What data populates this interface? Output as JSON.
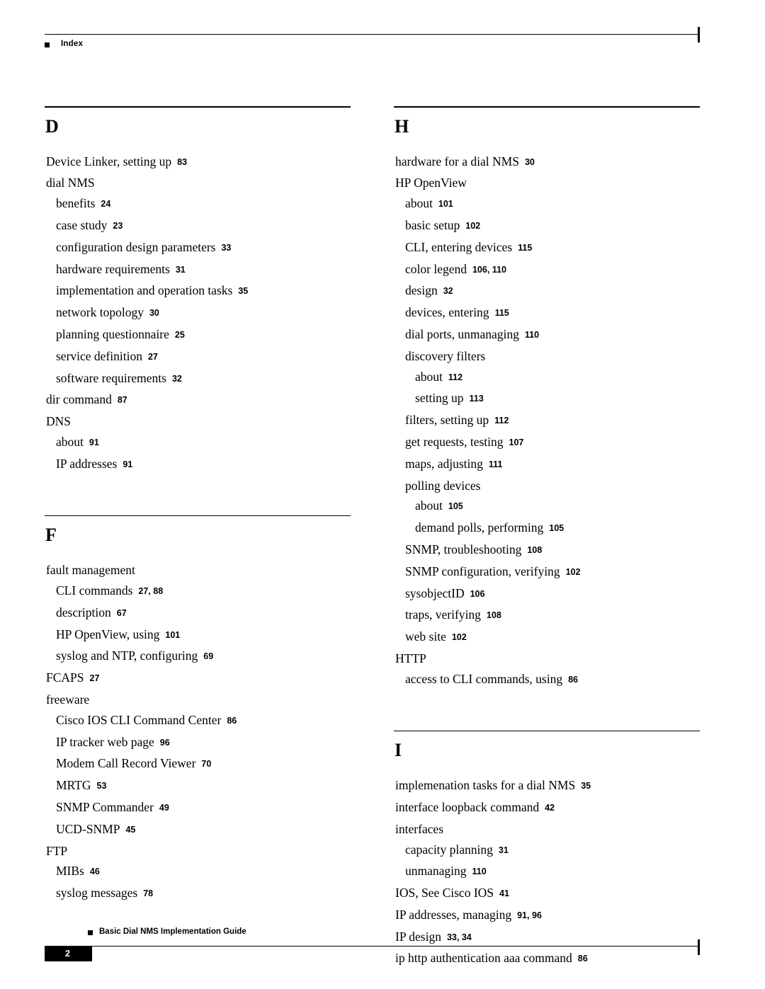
{
  "header": {
    "label": "Index"
  },
  "footer": {
    "guide_title": "Basic Dial NMS Implementation Guide",
    "page_number": "2"
  },
  "columns": [
    {
      "name": "left",
      "blocks": [
        {
          "letter": "D",
          "entries": [
            {
              "level": 1,
              "text": "Device Linker, setting up",
              "pages": "83"
            },
            {
              "level": 1,
              "text": "dial NMS",
              "pages": ""
            },
            {
              "level": 2,
              "text": "benefits",
              "pages": "24"
            },
            {
              "level": 2,
              "text": "case study",
              "pages": "23"
            },
            {
              "level": 2,
              "text": "configuration design parameters",
              "pages": "33"
            },
            {
              "level": 2,
              "text": "hardware requirements",
              "pages": "31"
            },
            {
              "level": 2,
              "text": "implementation and operation tasks",
              "pages": "35"
            },
            {
              "level": 2,
              "text": "network topology",
              "pages": "30"
            },
            {
              "level": 2,
              "text": "planning questionnaire",
              "pages": "25"
            },
            {
              "level": 2,
              "text": "service definition",
              "pages": "27"
            },
            {
              "level": 2,
              "text": "software requirements",
              "pages": "32"
            },
            {
              "level": 1,
              "text": "dir command",
              "pages": "87"
            },
            {
              "level": 1,
              "text": "DNS",
              "pages": ""
            },
            {
              "level": 2,
              "text": "about",
              "pages": "91"
            },
            {
              "level": 2,
              "text": "IP addresses",
              "pages": "91"
            }
          ]
        },
        {
          "letter": "F",
          "entries": [
            {
              "level": 1,
              "text": "fault management",
              "pages": ""
            },
            {
              "level": 2,
              "text": "CLI commands",
              "pages": "27, 88"
            },
            {
              "level": 2,
              "text": "description",
              "pages": "67"
            },
            {
              "level": 2,
              "text": "HP OpenView, using",
              "pages": "101"
            },
            {
              "level": 2,
              "text": "syslog and NTP, configuring",
              "pages": "69"
            },
            {
              "level": 1,
              "text": "FCAPS",
              "pages": "27"
            },
            {
              "level": 1,
              "text": "freeware",
              "pages": ""
            },
            {
              "level": 2,
              "text": "Cisco IOS CLI Command Center",
              "pages": "86"
            },
            {
              "level": 2,
              "text": "IP tracker web page",
              "pages": "96"
            },
            {
              "level": 2,
              "text": "Modem Call Record Viewer",
              "pages": "70"
            },
            {
              "level": 2,
              "text": "MRTG",
              "pages": "53"
            },
            {
              "level": 2,
              "text": "SNMP Commander",
              "pages": "49"
            },
            {
              "level": 2,
              "text": "UCD-SNMP",
              "pages": "45"
            },
            {
              "level": 1,
              "text": "FTP",
              "pages": ""
            },
            {
              "level": 2,
              "text": "MIBs",
              "pages": "46"
            },
            {
              "level": 2,
              "text": "syslog messages",
              "pages": "78"
            }
          ]
        }
      ]
    },
    {
      "name": "right",
      "blocks": [
        {
          "letter": "H",
          "entries": [
            {
              "level": 1,
              "text": "hardware for a dial NMS",
              "pages": "30"
            },
            {
              "level": 1,
              "text": "HP OpenView",
              "pages": ""
            },
            {
              "level": 2,
              "text": "about",
              "pages": "101"
            },
            {
              "level": 2,
              "text": "basic setup",
              "pages": "102"
            },
            {
              "level": 2,
              "text": "CLI, entering devices",
              "pages": "115"
            },
            {
              "level": 2,
              "text": "color legend",
              "pages": "106, 110"
            },
            {
              "level": 2,
              "text": "design",
              "pages": "32"
            },
            {
              "level": 2,
              "text": "devices, entering",
              "pages": "115"
            },
            {
              "level": 2,
              "text": "dial ports, unmanaging",
              "pages": "110"
            },
            {
              "level": 2,
              "text": "discovery filters",
              "pages": ""
            },
            {
              "level": 3,
              "text": "about",
              "pages": "112"
            },
            {
              "level": 3,
              "text": "setting up",
              "pages": "113"
            },
            {
              "level": 2,
              "text": "filters, setting up",
              "pages": "112"
            },
            {
              "level": 2,
              "text": "get requests, testing",
              "pages": "107"
            },
            {
              "level": 2,
              "text": "maps, adjusting",
              "pages": "111"
            },
            {
              "level": 2,
              "text": "polling devices",
              "pages": ""
            },
            {
              "level": 3,
              "text": "about",
              "pages": "105"
            },
            {
              "level": 3,
              "text": "demand polls, performing",
              "pages": "105"
            },
            {
              "level": 2,
              "text": "SNMP, troubleshooting",
              "pages": "108"
            },
            {
              "level": 2,
              "text": "SNMP configuration, verifying",
              "pages": "102"
            },
            {
              "level": 2,
              "text": "sysobjectID",
              "pages": "106"
            },
            {
              "level": 2,
              "text": "traps, verifying",
              "pages": "108"
            },
            {
              "level": 2,
              "text": "web site",
              "pages": "102"
            },
            {
              "level": 1,
              "text": "HTTP",
              "pages": ""
            },
            {
              "level": 2,
              "text": "access to CLI commands, using",
              "pages": "86"
            }
          ]
        },
        {
          "letter": "I",
          "entries": [
            {
              "level": 1,
              "text": "implemenation tasks for a dial NMS",
              "pages": "35"
            },
            {
              "level": 1,
              "text": "interface loopback command",
              "pages": "42"
            },
            {
              "level": 1,
              "text": "interfaces",
              "pages": ""
            },
            {
              "level": 2,
              "text": "capacity planning",
              "pages": "31"
            },
            {
              "level": 2,
              "text": "unmanaging",
              "pages": "110"
            },
            {
              "level": 1,
              "text": "IOS, See Cisco IOS",
              "pages": "41"
            },
            {
              "level": 1,
              "text": "IP addresses, managing",
              "pages": "91, 96"
            },
            {
              "level": 1,
              "text": "IP design",
              "pages": "33, 34"
            },
            {
              "level": 1,
              "text": "ip http authentication aaa command",
              "pages": "86"
            }
          ]
        }
      ]
    }
  ]
}
